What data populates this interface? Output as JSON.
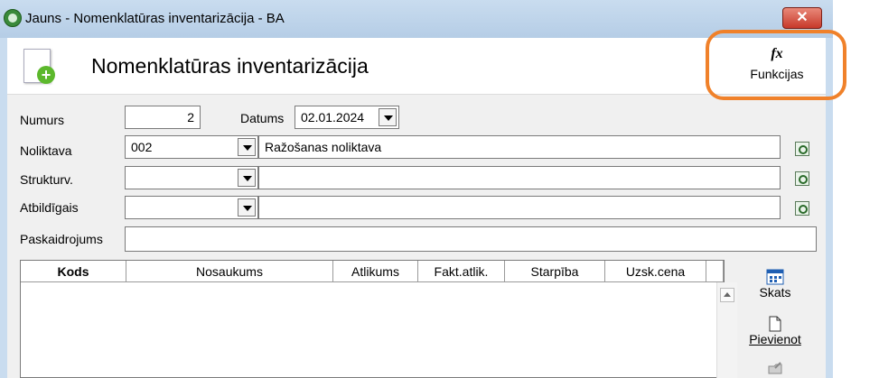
{
  "window": {
    "title": "Jauns - Nomenklatūras inventarizācija - BA",
    "close_label": "✕"
  },
  "header": {
    "title": "Nomenklatūras inventarizācija",
    "functions_label": "Funkcijas",
    "functions_icon": "fx-icon"
  },
  "form": {
    "numurs_label": "Numurs",
    "numurs_value": "2",
    "datums_label": "Datums",
    "datums_value": "02.01.2024",
    "noliktava_label": "Noliktava",
    "noliktava_code": "002",
    "noliktava_name": "Ražošanas noliktava",
    "strukturv_label": "Strukturv.",
    "strukturv_code": "",
    "strukturv_name": "",
    "atbildigais_label": "Atbildīgais",
    "atbildigais_code": "",
    "atbildigais_name": "",
    "paskaidrojums_label": "Paskaidrojums",
    "paskaidrojums_value": ""
  },
  "grid": {
    "columns": [
      "Kods",
      "Nosaukums",
      "Atlikums",
      "Fakt.atlik.",
      "Starpība",
      "Uzsk.cena"
    ]
  },
  "side": {
    "skats_label": "Skats",
    "pievienot_label": "Pievienot"
  },
  "colors": {
    "highlight": "#f0812a",
    "titlebar": "#c9dcef"
  }
}
